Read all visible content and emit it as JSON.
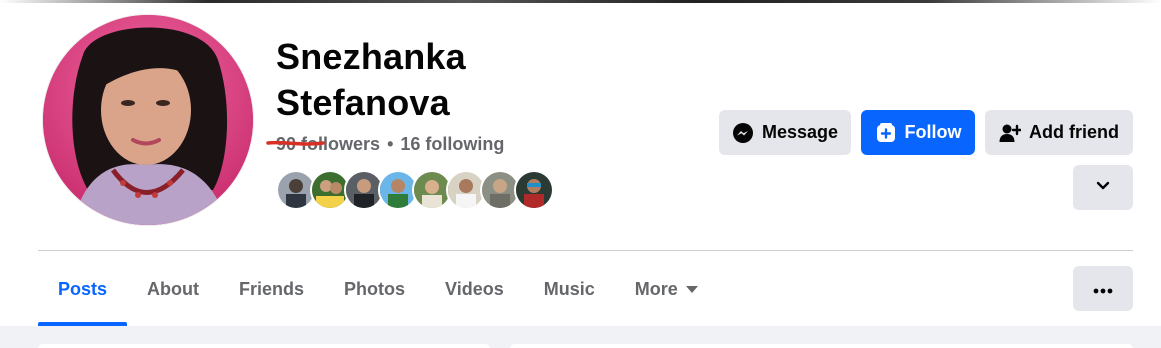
{
  "profile": {
    "name": "Snezhanka Stefanova",
    "name_line1": "Snezhanka",
    "name_line2": "Stefanova",
    "followers": "90 followers",
    "separator": "•",
    "following": "16 following"
  },
  "actions": {
    "message_label": "Message",
    "follow_label": "Follow",
    "add_friend_label": "Add friend"
  },
  "tabs": [
    {
      "label": "Posts",
      "active": true
    },
    {
      "label": "About",
      "active": false
    },
    {
      "label": "Friends",
      "active": false
    },
    {
      "label": "Photos",
      "active": false
    },
    {
      "label": "Videos",
      "active": false
    },
    {
      "label": "Music",
      "active": false
    },
    {
      "label": "More",
      "active": false
    }
  ],
  "icons": {
    "message": "messenger-icon",
    "follow": "follow-plus-icon",
    "add_friend": "add-friend-icon",
    "dropdown": "chevron-down-icon",
    "more_tab": "caret-down-icon",
    "overflow": "ellipsis-icon"
  },
  "colors": {
    "accent": "#0866ff",
    "secondary_button": "#e4e6eb",
    "muted_text": "#65676b",
    "annotation_strike": "#d93025"
  },
  "mutual_friend_avatars": 8
}
